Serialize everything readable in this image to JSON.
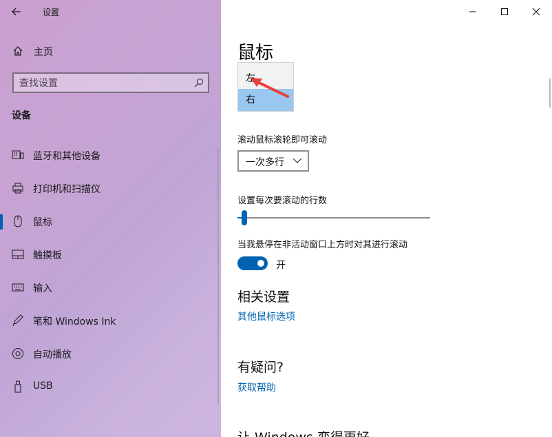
{
  "window": {
    "title": "设置",
    "controls": [
      "minimize",
      "maximize",
      "close"
    ]
  },
  "sidebar": {
    "home_label": "主页",
    "search_placeholder": "查找设置",
    "section_title": "设备",
    "items": [
      {
        "label": "蓝牙和其他设备",
        "icon": "bluetooth-devices-icon"
      },
      {
        "label": "打印机和扫描仪",
        "icon": "printer-icon"
      },
      {
        "label": "鼠标",
        "icon": "mouse-icon",
        "active": true
      },
      {
        "label": "触摸板",
        "icon": "touchpad-icon"
      },
      {
        "label": "输入",
        "icon": "keyboard-icon"
      },
      {
        "label": "笔和 Windows Ink",
        "icon": "pen-icon"
      },
      {
        "label": "自动播放",
        "icon": "autoplay-icon"
      },
      {
        "label": "USB",
        "icon": "usb-icon"
      }
    ]
  },
  "main": {
    "title": "鼠标",
    "primary_button": {
      "options": [
        "左",
        "右"
      ],
      "selected": "右"
    },
    "scroll_label": "滚动鼠标滚轮即可滚动",
    "scroll_value": "一次多行",
    "lines_label": "设置每次要滚动的行数",
    "lines_value_fraction": 0.03,
    "inactive_scroll_label": "当我悬停在非活动窗口上方时对其进行滚动",
    "inactive_scroll_state": "开",
    "related_title": "相关设置",
    "related_link": "其他鼠标选项",
    "question_title": "有疑问?",
    "help_link": "获取帮助",
    "improve_title": "让 Windows 变得更好"
  },
  "colors": {
    "accent": "#0063b1",
    "selected_option": "#99c7ef",
    "annotation_arrow": "#e8403c"
  }
}
